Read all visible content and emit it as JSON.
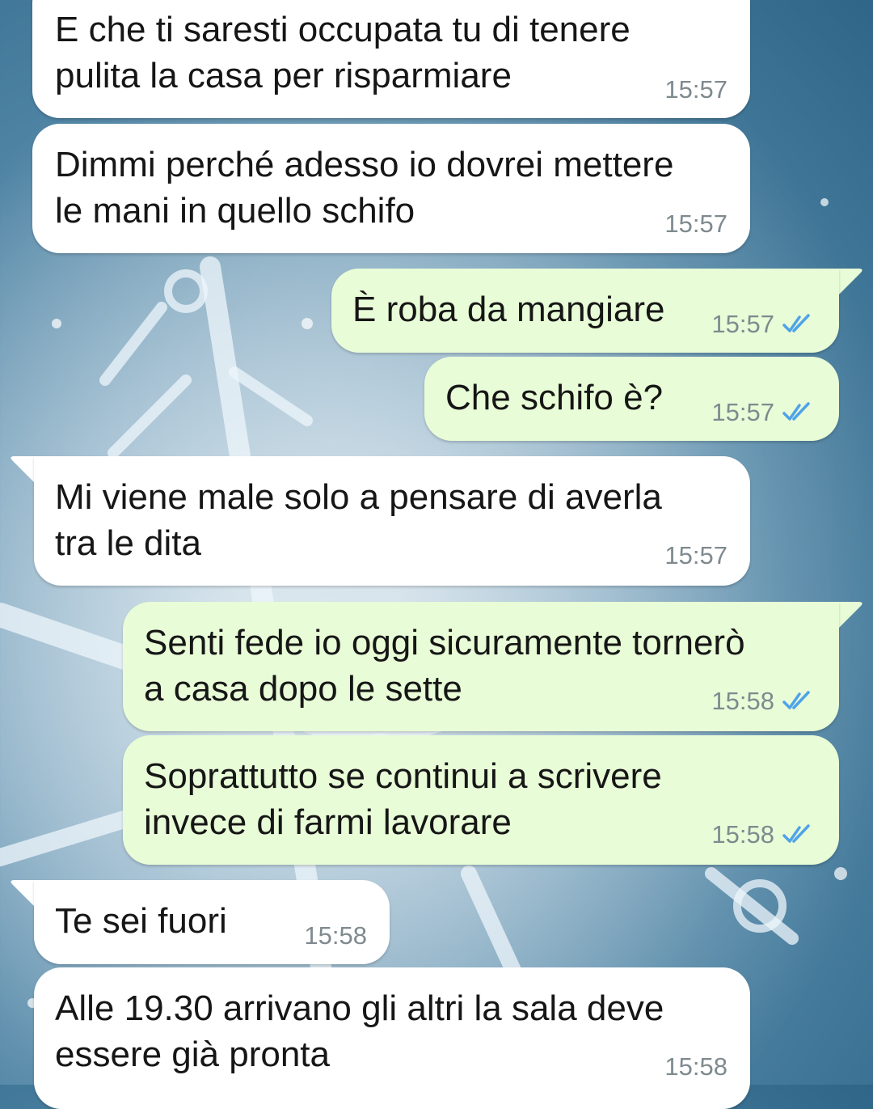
{
  "chat": {
    "messages": [
      {
        "direction": "incoming",
        "text": "E che ti saresti occupata tu di tenere\npulita la casa per risparmiare",
        "time": "15:57"
      },
      {
        "direction": "incoming",
        "text": "Dimmi perché adesso io dovrei mettere\nle mani in quello schifo",
        "time": "15:57"
      },
      {
        "direction": "outgoing",
        "text": "È roba da mangiare",
        "time": "15:57",
        "status": "read"
      },
      {
        "direction": "outgoing",
        "text": "Che schifo è?",
        "time": "15:57",
        "status": "read"
      },
      {
        "direction": "incoming",
        "text": "Mi viene male solo a pensare di averla\ntra le dita",
        "time": "15:57"
      },
      {
        "direction": "outgoing",
        "text": "Senti fede io oggi sicuramente tornerò\na casa dopo le sette",
        "time": "15:58",
        "status": "read"
      },
      {
        "direction": "outgoing",
        "text": "Soprattutto se continui a scrivere\ninvece di farmi lavorare",
        "time": "15:58",
        "status": "read"
      },
      {
        "direction": "incoming",
        "text": "Te sei fuori",
        "time": "15:58"
      },
      {
        "direction": "incoming",
        "text": "Alle 19.30 arrivano gli altri la sala deve\nessere già pronta",
        "time": "15:58"
      }
    ]
  },
  "colors": {
    "incoming_bubble": "#ffffff",
    "outgoing_bubble": "#e8fcd7",
    "read_tick": "#4fa3e8",
    "time_text": "#7f8a8f"
  },
  "icons": {
    "read_receipt": "double-check-icon",
    "wallpaper": "snowflake-wallpaper"
  }
}
